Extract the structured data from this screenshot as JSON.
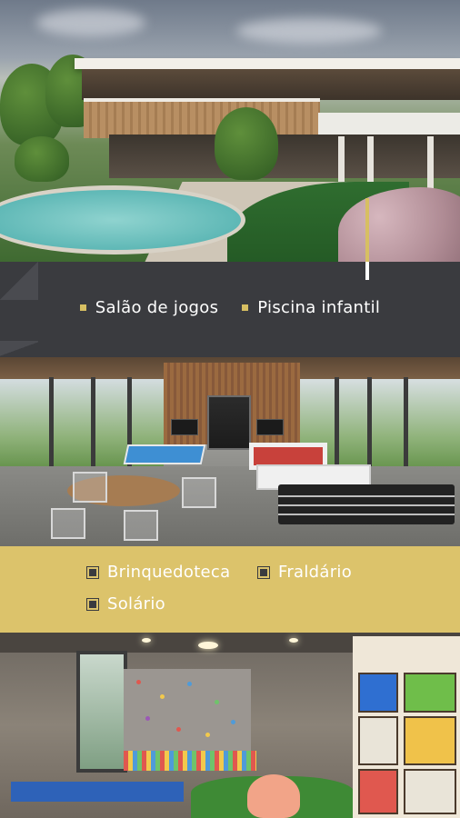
{
  "amenities_top": {
    "items": [
      "Salão de jogos",
      "Piscina infantil"
    ]
  },
  "amenities_middle": {
    "items": [
      "Brinquedoteca",
      "Fraldário",
      "Solário"
    ]
  },
  "colors": {
    "dark_band": "#3a3b3f",
    "gold_band": "#dcc36b",
    "accent_gold": "#d7bf62",
    "text": "#ffffff"
  },
  "icons": {
    "bullet_top": "gold-square-bullet",
    "bullet_middle": "dark-square-bullet"
  }
}
